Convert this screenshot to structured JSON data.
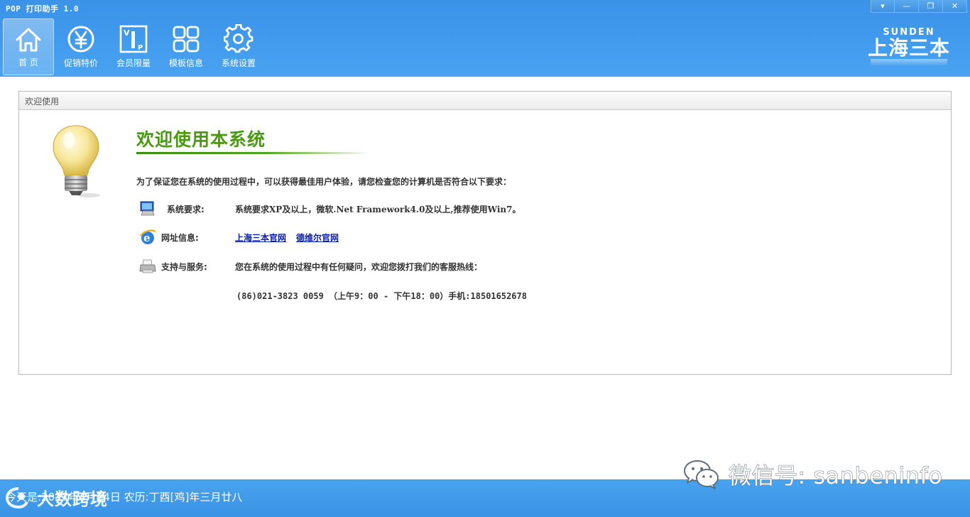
{
  "window": {
    "title": "POP 打印助手 1.0",
    "controls": {
      "dropdown": "▾",
      "minimize": "—",
      "restore": "❐",
      "close": "✕"
    }
  },
  "toolbar": {
    "items": [
      {
        "label": "首  页",
        "icon": "home-icon",
        "active": true
      },
      {
        "label": "促销特价",
        "icon": "yen-coin-icon",
        "active": false
      },
      {
        "label": "会员限量",
        "icon": "vip-icon",
        "active": false
      },
      {
        "label": "模板信息",
        "icon": "grid-icon",
        "active": false
      },
      {
        "label": "系统设置",
        "icon": "gear-icon",
        "active": false
      }
    ]
  },
  "brand": {
    "en": "SUNDEN",
    "cn": "上海三本"
  },
  "panel": {
    "header": "欢迎使用",
    "title": "欢迎使用本系统",
    "intro": "为了保证您在系统的使用过程中，可以获得最佳用户体验，请您检查您的计算机是否符合以下要求：",
    "requirements": {
      "label": "系统要求:",
      "value": "系统要求XP及以上，微软.Net Framework4.0及以上,推荐使用Win7。",
      "icon": "computer-icon"
    },
    "website": {
      "label": "网址信息:",
      "links": [
        "上海三本官网",
        "德维尔官网"
      ],
      "icon": "ie-browser-icon"
    },
    "support": {
      "label": "支持与服务:",
      "value": "您在系统的使用过程中有任何疑问，欢迎您拨打我们的客服热线：",
      "phone": "(86)021-3823 0059 （上午9：00 - 下午18：00）手机:18501652678",
      "icon": "printer-icon"
    }
  },
  "status": {
    "text": "今天是:2017年4月24日 农历:丁酉[鸡]年三月廿八"
  },
  "watermarks": {
    "left": "大数跨境",
    "right": "微信号: sanbeninfo"
  },
  "colors": {
    "titlebar": "#3f98ec",
    "accent_green": "#4a9a10",
    "link_blue": "#0a1ea8"
  }
}
